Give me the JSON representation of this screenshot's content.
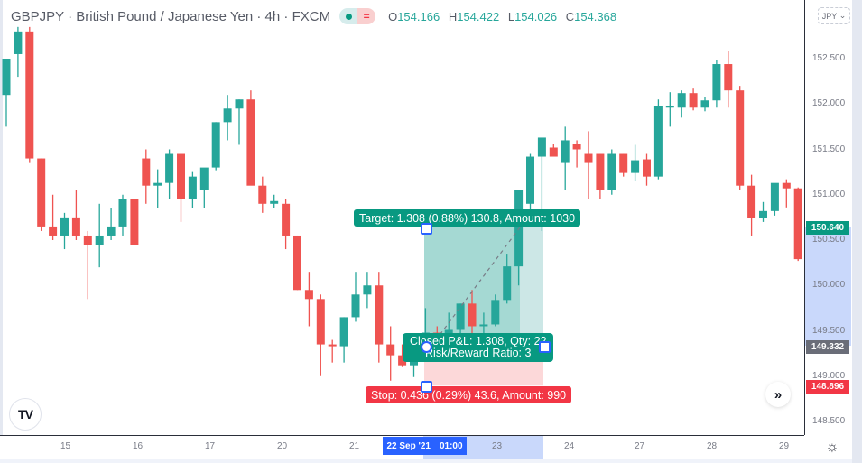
{
  "header": {
    "symbol": "GBPJPY",
    "name": "British Pound / Japanese Yen",
    "interval": "4h",
    "exchange": "FXCM",
    "title": "GBPJPY · British Pound / Japanese Yen · 4h  · FXCM",
    "ohlc": {
      "O_label": "O",
      "O": "154.166",
      "H_label": "H",
      "H": "154.422",
      "L_label": "L",
      "L": "154.026",
      "C_label": "C",
      "C": "154.368"
    }
  },
  "currency": "JPY",
  "colors": {
    "up": "#26a69a",
    "down": "#ef5350",
    "target": "#089981",
    "stop": "#f23645",
    "selection": "#2962ff"
  },
  "price_axis": {
    "ticks": [
      "152.500",
      "152.000",
      "151.500",
      "151.000",
      "150.500",
      "150.000",
      "149.500",
      "149.000",
      "148.500"
    ],
    "labels": {
      "target": "150.640",
      "current": "149.332",
      "stop": "148.896"
    }
  },
  "time_axis": {
    "ticks": [
      "15",
      "16",
      "17",
      "20",
      "21",
      "23",
      "24",
      "27",
      "28",
      "29"
    ],
    "selected_date": "22 Sep '21",
    "selected_time": "01:00"
  },
  "position": {
    "target_label": "Target: 1.308 (0.88%) 130.8, Amount: 1030",
    "stop_label": "Stop: 0.436 (0.29%) 43.6, Amount: 990",
    "pnl_line1": "Closed P&L: 1.308, Qty: 22",
    "pnl_line2": "Risk/Reward Ratio: 3",
    "entry": 149.332,
    "target": 150.64,
    "stop": 148.896
  },
  "buttons": {
    "scroll_label": "»",
    "logo": "TV",
    "settings": "⚙"
  },
  "chart_data": {
    "type": "candlestick",
    "title": "GBPJPY · British Pound / Japanese Yen · 4h · FXCM",
    "ylim": [
      148.3,
      153.0
    ],
    "candles": [
      {
        "o": 152.1,
        "h": 152.3,
        "l": 151.75,
        "c": 152.5
      },
      {
        "o": 152.55,
        "h": 152.85,
        "l": 152.3,
        "c": 152.8
      },
      {
        "o": 152.8,
        "h": 152.85,
        "l": 151.35,
        "c": 151.4
      },
      {
        "o": 151.4,
        "h": 151.4,
        "l": 150.6,
        "c": 150.65
      },
      {
        "o": 150.65,
        "h": 151.0,
        "l": 150.5,
        "c": 150.55
      },
      {
        "o": 150.55,
        "h": 150.8,
        "l": 150.4,
        "c": 150.75
      },
      {
        "o": 150.75,
        "h": 151.05,
        "l": 150.5,
        "c": 150.55
      },
      {
        "o": 150.55,
        "h": 150.6,
        "l": 149.85,
        "c": 150.45
      },
      {
        "o": 150.45,
        "h": 150.9,
        "l": 150.2,
        "c": 150.55
      },
      {
        "o": 150.55,
        "h": 150.85,
        "l": 150.5,
        "c": 150.65
      },
      {
        "o": 150.65,
        "h": 151.0,
        "l": 150.55,
        "c": 150.95
      },
      {
        "o": 150.95,
        "h": 150.95,
        "l": 150.45,
        "c": 150.45
      },
      {
        "o": 151.4,
        "h": 151.5,
        "l": 150.9,
        "c": 151.1
      },
      {
        "o": 151.1,
        "h": 151.28,
        "l": 150.85,
        "c": 151.13
      },
      {
        "o": 151.13,
        "h": 151.5,
        "l": 150.95,
        "c": 151.45
      },
      {
        "o": 151.45,
        "h": 151.45,
        "l": 150.7,
        "c": 150.95
      },
      {
        "o": 150.95,
        "h": 151.25,
        "l": 150.85,
        "c": 151.2
      },
      {
        "o": 151.05,
        "h": 151.25,
        "l": 150.85,
        "c": 151.3
      },
      {
        "o": 151.3,
        "h": 151.8,
        "l": 151.27,
        "c": 151.8
      },
      {
        "o": 151.8,
        "h": 152.1,
        "l": 151.6,
        "c": 151.95
      },
      {
        "o": 151.95,
        "h": 152.05,
        "l": 151.55,
        "c": 152.05
      },
      {
        "o": 152.05,
        "h": 152.15,
        "l": 151.25,
        "c": 151.1
      },
      {
        "o": 151.1,
        "h": 151.2,
        "l": 150.8,
        "c": 150.9
      },
      {
        "o": 150.9,
        "h": 151.0,
        "l": 150.85,
        "c": 150.93
      },
      {
        "o": 150.9,
        "h": 150.95,
        "l": 150.4,
        "c": 150.55
      },
      {
        "o": 150.55,
        "h": 150.55,
        "l": 149.95,
        "c": 149.95
      },
      {
        "o": 149.95,
        "h": 150.15,
        "l": 149.55,
        "c": 149.85
      },
      {
        "o": 149.85,
        "h": 149.9,
        "l": 149.0,
        "c": 149.35
      },
      {
        "o": 149.35,
        "h": 149.4,
        "l": 149.15,
        "c": 149.33
      },
      {
        "o": 149.33,
        "h": 149.65,
        "l": 149.15,
        "c": 149.65
      },
      {
        "o": 149.65,
        "h": 150.15,
        "l": 149.6,
        "c": 149.9
      },
      {
        "o": 149.9,
        "h": 150.15,
        "l": 149.75,
        "c": 150.0
      },
      {
        "o": 150.0,
        "h": 150.15,
        "l": 149.15,
        "c": 149.35
      },
      {
        "o": 149.35,
        "h": 149.55,
        "l": 148.95,
        "c": 149.23
      },
      {
        "o": 149.23,
        "h": 149.35,
        "l": 149.1,
        "c": 149.12
      },
      {
        "o": 149.12,
        "h": 149.16,
        "l": 148.99,
        "c": 149.16
      },
      {
        "o": 149.45,
        "h": 149.75,
        "l": 149.3,
        "c": 149.48
      },
      {
        "o": 149.48,
        "h": 149.55,
        "l": 149.35,
        "c": 149.45
      },
      {
        "o": 149.45,
        "h": 149.7,
        "l": 149.35,
        "c": 149.51
      },
      {
        "o": 149.51,
        "h": 149.8,
        "l": 149.4,
        "c": 149.8
      },
      {
        "o": 149.8,
        "h": 149.95,
        "l": 149.45,
        "c": 149.55
      },
      {
        "o": 149.55,
        "h": 149.7,
        "l": 149.4,
        "c": 149.57
      },
      {
        "o": 149.57,
        "h": 149.9,
        "l": 149.55,
        "c": 149.84
      },
      {
        "o": 149.84,
        "h": 150.35,
        "l": 149.8,
        "c": 150.21
      },
      {
        "o": 150.21,
        "h": 150.9,
        "l": 150.0,
        "c": 151.05
      },
      {
        "o": 150.9,
        "h": 151.45,
        "l": 150.75,
        "c": 151.42
      },
      {
        "o": 151.42,
        "h": 151.55,
        "l": 150.6,
        "c": 151.63
      },
      {
        "o": 151.52,
        "h": 151.56,
        "l": 151.45,
        "c": 151.42
      },
      {
        "o": 151.35,
        "h": 151.75,
        "l": 151.05,
        "c": 151.6
      },
      {
        "o": 151.56,
        "h": 151.6,
        "l": 151.3,
        "c": 151.5
      },
      {
        "o": 151.45,
        "h": 151.7,
        "l": 150.95,
        "c": 151.35
      },
      {
        "o": 151.45,
        "h": 151.45,
        "l": 150.95,
        "c": 151.05
      },
      {
        "o": 151.05,
        "h": 151.5,
        "l": 151.0,
        "c": 151.45
      },
      {
        "o": 151.45,
        "h": 151.45,
        "l": 151.2,
        "c": 151.24
      },
      {
        "o": 151.24,
        "h": 151.55,
        "l": 151.15,
        "c": 151.38
      },
      {
        "o": 151.39,
        "h": 151.45,
        "l": 151.1,
        "c": 151.2
      },
      {
        "o": 151.2,
        "h": 152.05,
        "l": 151.17,
        "c": 151.98
      },
      {
        "o": 151.96,
        "h": 152.13,
        "l": 151.75,
        "c": 151.98
      },
      {
        "o": 151.96,
        "h": 152.15,
        "l": 151.85,
        "c": 152.12
      },
      {
        "o": 152.12,
        "h": 152.17,
        "l": 151.93,
        "c": 151.96
      },
      {
        "o": 151.96,
        "h": 152.08,
        "l": 151.92,
        "c": 152.04
      },
      {
        "o": 152.04,
        "h": 152.48,
        "l": 151.96,
        "c": 152.44
      },
      {
        "o": 152.44,
        "h": 152.58,
        "l": 151.96,
        "c": 152.15
      },
      {
        "o": 152.15,
        "h": 152.2,
        "l": 151.05,
        "c": 151.1
      },
      {
        "o": 151.1,
        "h": 151.22,
        "l": 150.55,
        "c": 150.74
      },
      {
        "o": 150.74,
        "h": 150.92,
        "l": 150.7,
        "c": 150.82
      },
      {
        "o": 150.82,
        "h": 151.12,
        "l": 150.77,
        "c": 151.13
      },
      {
        "o": 151.13,
        "h": 151.17,
        "l": 150.86,
        "c": 151.07
      },
      {
        "o": 151.07,
        "h": 151.08,
        "l": 150.27,
        "c": 150.29
      }
    ]
  }
}
